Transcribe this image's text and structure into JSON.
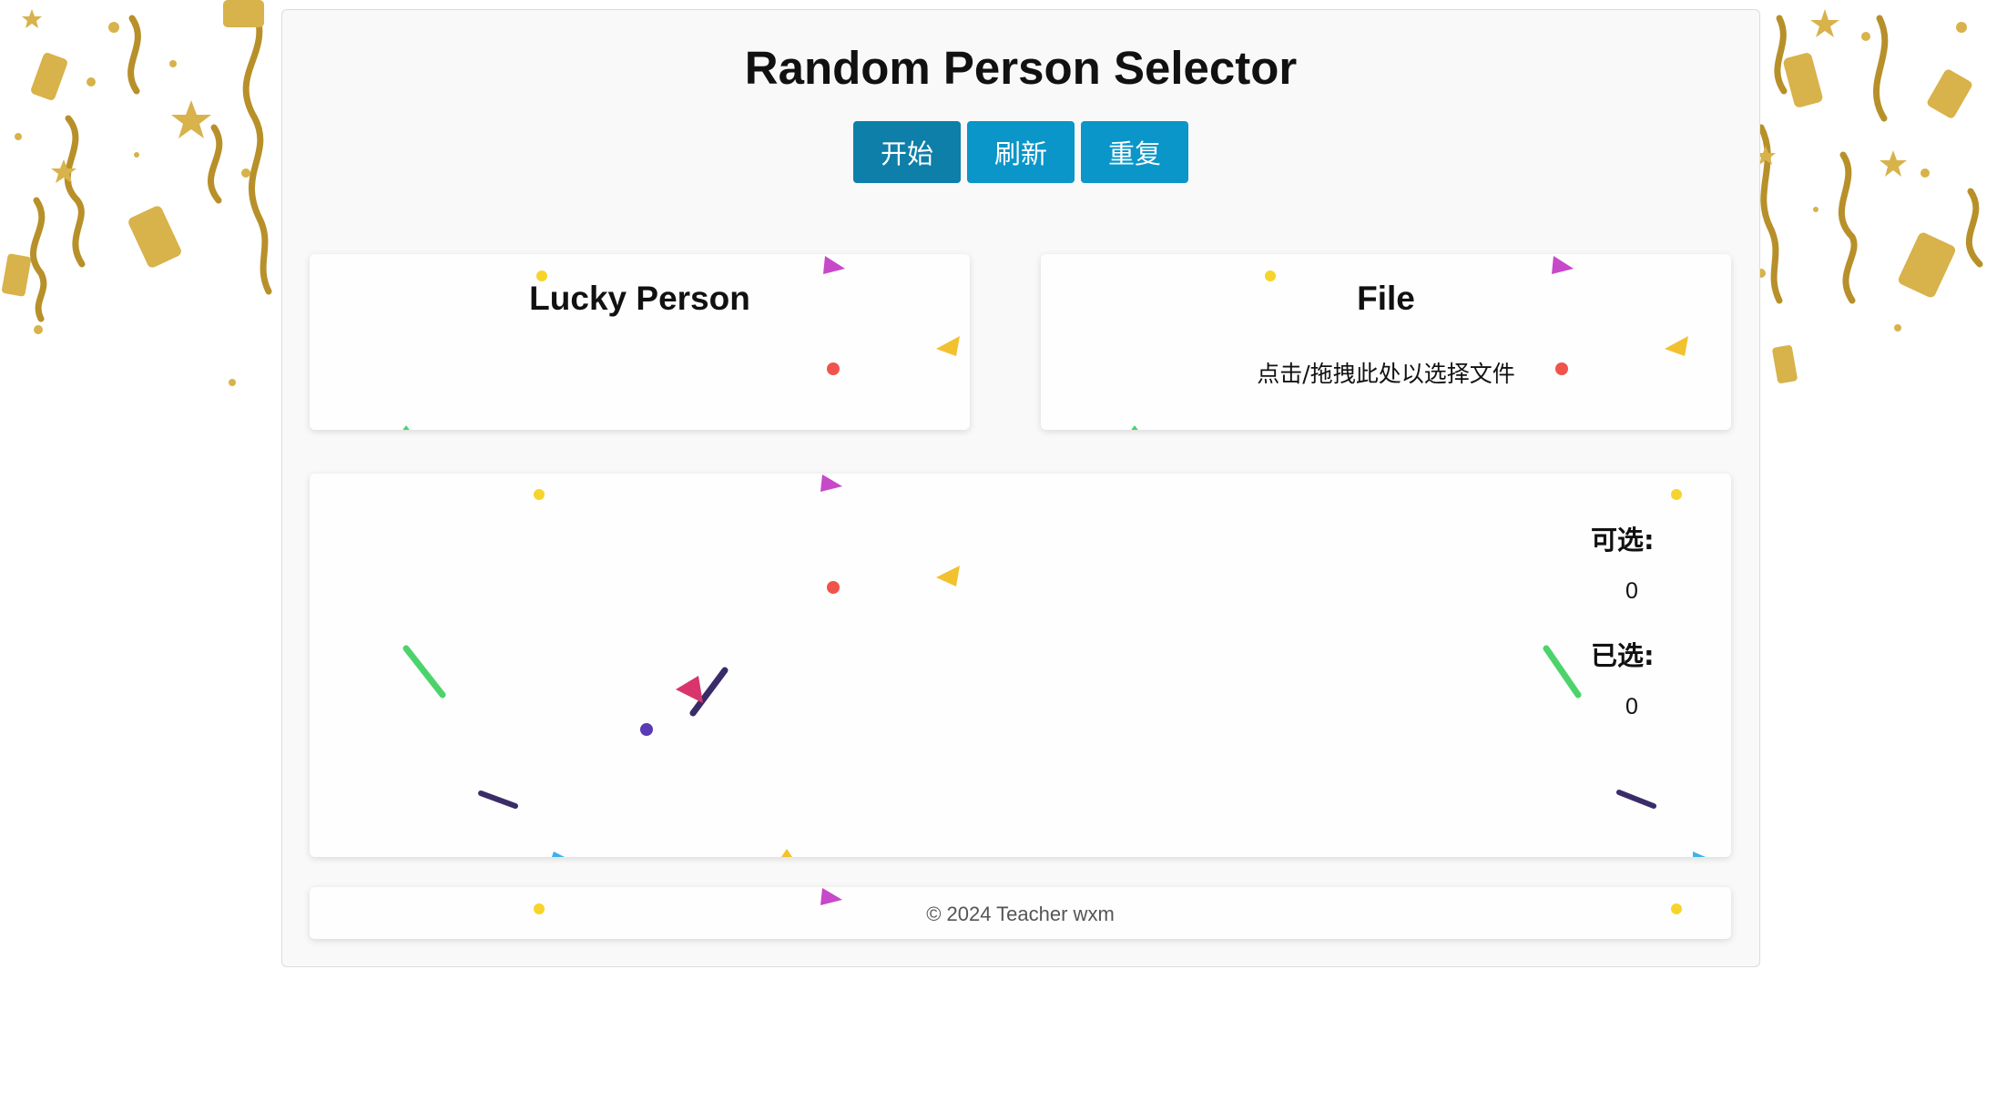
{
  "header": {
    "title": "Random Person Selector"
  },
  "buttons": {
    "start": "开始",
    "refresh": "刷新",
    "repeat": "重复"
  },
  "lucky_card": {
    "title": "Lucky Person"
  },
  "file_card": {
    "title": "File",
    "hint": "点击/拖拽此处以选择文件"
  },
  "stats": {
    "available_label": "可选:",
    "available_value": "0",
    "selected_label": "已选:",
    "selected_value": "0"
  },
  "footer": {
    "text": "© 2024 Teacher wxm"
  },
  "colors": {
    "primary_button": "#0e7fa8",
    "secondary_button": "#0a96c8",
    "gold_decoration": "#c9a227"
  },
  "icons": [
    "gold-confetti-decoration",
    "colored-confetti"
  ]
}
